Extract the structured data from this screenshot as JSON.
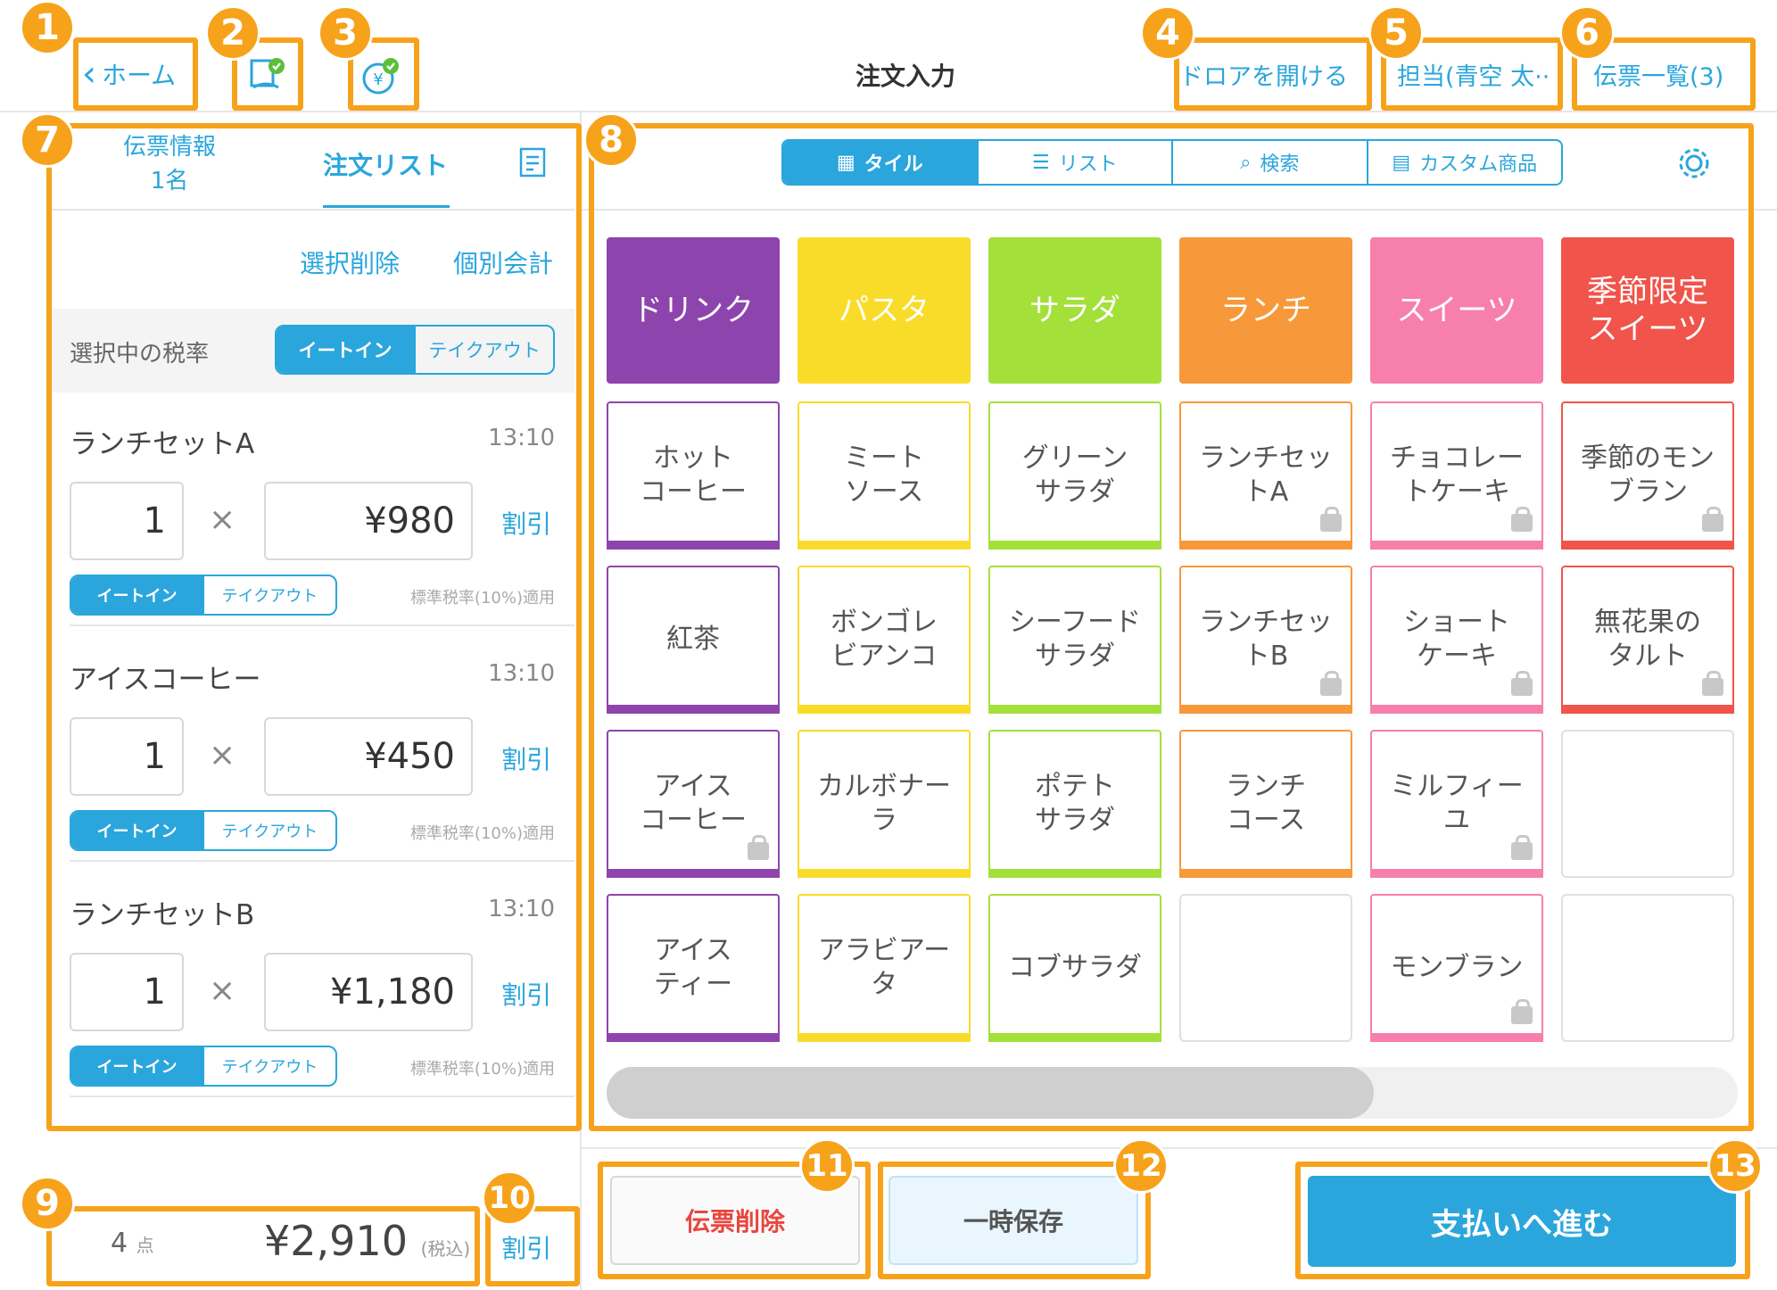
{
  "header": {
    "back_label": "ホーム",
    "title": "注文入力",
    "drawer_label": "ドロアを開ける",
    "staff_label": "担当(青空 太··",
    "slips_label": "伝票一覧(3)"
  },
  "annotations": [
    "1",
    "2",
    "3",
    "4",
    "5",
    "6",
    "7",
    "8",
    "9",
    "10",
    "11",
    "12",
    "13"
  ],
  "left": {
    "tab_info": "伝票情報",
    "tab_info_sub": "1名",
    "tab_orders": "注文リスト",
    "delete_selected": "選択削除",
    "separate_pay": "個別会計",
    "tax_rate_label": "選択中の税率",
    "eat_in": "イートイン",
    "takeout": "テイクアウト",
    "items": [
      {
        "name": "ランチセットA",
        "time": "13:10",
        "qty": "1",
        "times": "×",
        "price": "¥980",
        "discount": "割引",
        "tax_note": "標準税率(10%)適用"
      },
      {
        "name": "アイスコーヒー",
        "time": "13:10",
        "qty": "1",
        "times": "×",
        "price": "¥450",
        "discount": "割引",
        "tax_note": "標準税率(10%)適用"
      },
      {
        "name": "ランチセットB",
        "time": "13:10",
        "qty": "1",
        "times": "×",
        "price": "¥1,180",
        "discount": "割引",
        "tax_note": "標準税率(10%)適用"
      }
    ]
  },
  "total": {
    "count": "4",
    "count_unit": "点",
    "amount": "¥2,910",
    "tax_incl": "(税込)",
    "discount": "割引"
  },
  "view_tabs": {
    "tile": "タイル",
    "list": "リスト",
    "search": "検索",
    "custom": "カスタム商品"
  },
  "categories": [
    {
      "label": "ドリンク",
      "color": "#8e44ad"
    },
    {
      "label": "パスタ",
      "color": "#f9dc2a"
    },
    {
      "label": "サラダ",
      "color": "#a4e03a"
    },
    {
      "label": "ランチ",
      "color": "#f7993a"
    },
    {
      "label": "スイーツ",
      "color": "#f77fac"
    },
    {
      "label": "季節限定\nスイーツ",
      "color": "#f0544a"
    }
  ],
  "products": [
    [
      "ホット\nコーヒー",
      "ミート\nソース",
      "グリーン\nサラダ",
      "ランチセッ\nトA",
      "チョコレー\nトケーキ",
      "季節のモン\nブラン"
    ],
    [
      "紅茶",
      "ボンゴレ\nビアンコ",
      "シーフード\nサラダ",
      "ランチセッ\nトB",
      "ショート\nケーキ",
      "無花果の\nタルト"
    ],
    [
      "アイス\nコーヒー",
      "カルボナー\nラ",
      "ポテト\nサラダ",
      "ランチ\nコース",
      "ミルフィー\nユ",
      ""
    ],
    [
      "アイス\nティー",
      "アラビアー\nタ",
      "コブサラダ",
      "",
      "モンブラン",
      ""
    ]
  ],
  "footer": {
    "delete_slip": "伝票削除",
    "hold": "一時保存",
    "pay": "支払いへ進む"
  },
  "colors": {
    "accent": "#2aa6dc",
    "annotation": "#f7a21b",
    "danger": "#e8473f"
  }
}
